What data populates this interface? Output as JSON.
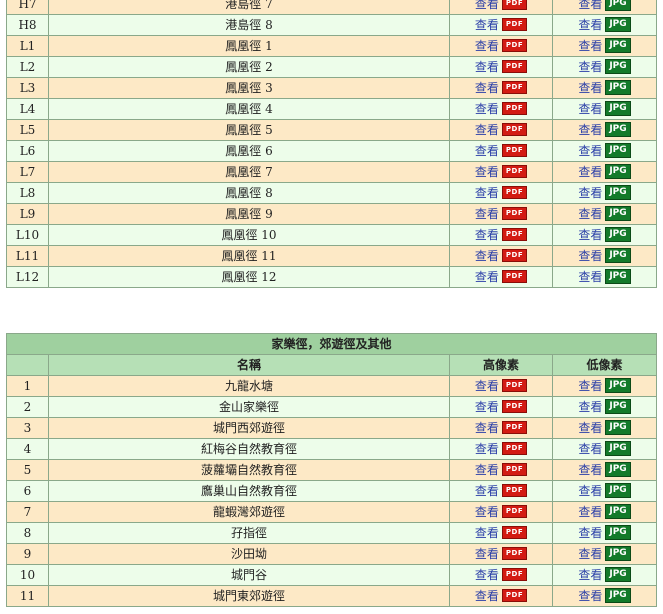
{
  "links": {
    "view_label": "查看",
    "pdf_badge": "PDF",
    "jpg_badge": "JPG"
  },
  "top_table": {
    "rows": [
      {
        "code": "H7",
        "name": "港島徑 7"
      },
      {
        "code": "H8",
        "name": "港島徑 8"
      },
      {
        "code": "L1",
        "name": "鳳凰徑 1"
      },
      {
        "code": "L2",
        "name": "鳳凰徑 2"
      },
      {
        "code": "L3",
        "name": "鳳凰徑 3"
      },
      {
        "code": "L4",
        "name": "鳳凰徑 4"
      },
      {
        "code": "L5",
        "name": "鳳凰徑 5"
      },
      {
        "code": "L6",
        "name": "鳳凰徑 6"
      },
      {
        "code": "L7",
        "name": "鳳凰徑 7"
      },
      {
        "code": "L8",
        "name": "鳳凰徑 8"
      },
      {
        "code": "L9",
        "name": "鳳凰徑 9"
      },
      {
        "code": "L10",
        "name": "鳳凰徑 10"
      },
      {
        "code": "L11",
        "name": "鳳凰徑 11"
      },
      {
        "code": "L12",
        "name": "鳳凰徑 12"
      }
    ]
  },
  "family_table": {
    "title": "家樂徑，郊遊徑及其他",
    "headers": {
      "no": "",
      "name": "名稱",
      "high": "高像素",
      "low": "低像素"
    },
    "rows": [
      {
        "code": "1",
        "name": "九龍水塘"
      },
      {
        "code": "2",
        "name": "金山家樂徑"
      },
      {
        "code": "3",
        "name": "城門西郊遊徑"
      },
      {
        "code": "4",
        "name": "紅梅谷自然教育徑"
      },
      {
        "code": "5",
        "name": "菠蘿壩自然教育徑"
      },
      {
        "code": "6",
        "name": "鷹巢山自然教育徑"
      },
      {
        "code": "7",
        "name": "龍蝦灣郊遊徑"
      },
      {
        "code": "8",
        "name": "孖指徑"
      },
      {
        "code": "9",
        "name": "沙田坳"
      },
      {
        "code": "10",
        "name": "城門谷"
      },
      {
        "code": "11",
        "name": "城門東郊遊徑"
      }
    ]
  },
  "colors": {
    "odd_row": "#fde9c6",
    "even_row": "#edfdea",
    "header": "#9fd09f",
    "link": "#2b3fa8",
    "pdf": "#d31b13",
    "jpg": "#137a2a"
  }
}
